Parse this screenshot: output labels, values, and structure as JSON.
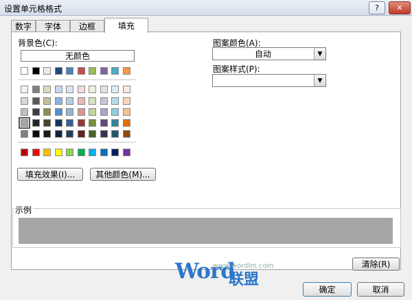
{
  "window": {
    "title": "设置单元格格式",
    "help_label": "?",
    "close_label": "✕"
  },
  "tabs": [
    {
      "label": "数字",
      "active": false
    },
    {
      "label": "字体",
      "active": false
    },
    {
      "label": "边框",
      "active": false
    },
    {
      "label": "填充",
      "active": true
    }
  ],
  "fill": {
    "background_label": "背景色(C):",
    "no_color_label": "无颜色",
    "pattern_color_label": "图案颜色(A):",
    "pattern_color_value": "自动",
    "pattern_style_label": "图案样式(P):",
    "pattern_style_value": "",
    "fill_effects_label": "填充效果(I)...",
    "more_colors_label": "其他颜色(M)...",
    "sample_label": "示例",
    "sample_color": "#a6a6a6",
    "clear_label": "清除(R)",
    "theme_top": [
      "#ffffff",
      "#000000",
      "#eeece1",
      "#1f497d",
      "#4f81bd",
      "#c0504d",
      "#9bbb59",
      "#8064a2",
      "#4bacc6",
      "#f79646"
    ],
    "theme_tints": [
      [
        "#f2f2f2",
        "#7f7f7f",
        "#ddd9c3",
        "#c6d9f0",
        "#dbe5f1",
        "#f2dcdb",
        "#ebf1dd",
        "#e5e0ec",
        "#dbeef3",
        "#fdeada"
      ],
      [
        "#d8d8d8",
        "#595959",
        "#c4bd97",
        "#8db3e2",
        "#b8cce4",
        "#e5b9b7",
        "#d7e3bc",
        "#ccc1d9",
        "#b7dde8",
        "#fbd5b5"
      ],
      [
        "#bfbfbf",
        "#3f3f3f",
        "#938953",
        "#548dd4",
        "#95b3d7",
        "#d99694",
        "#c3d69b",
        "#b2a2c7",
        "#92cddc",
        "#fac08f"
      ],
      [
        "#a5a5a5",
        "#262626",
        "#494429",
        "#17365d",
        "#366092",
        "#953734",
        "#76923c",
        "#5f497a",
        "#31859b",
        "#e36c09"
      ],
      [
        "#7f7f7f",
        "#0c0c0c",
        "#1d1b10",
        "#0f243e",
        "#244061",
        "#632423",
        "#4f6128",
        "#3f3151",
        "#205867",
        "#974806"
      ]
    ],
    "standard_colors": [
      "#c00000",
      "#ff0000",
      "#ffc000",
      "#ffff00",
      "#92d050",
      "#00b050",
      "#00b0f0",
      "#0070c0",
      "#002060",
      "#7030a0"
    ],
    "selected_swatch": "#a5a5a5"
  },
  "footer": {
    "ok_label": "确定",
    "cancel_label": "取消"
  },
  "watermark": {
    "url": "www.wordlm.com",
    "logo": "Word",
    "cn": "联盟"
  }
}
